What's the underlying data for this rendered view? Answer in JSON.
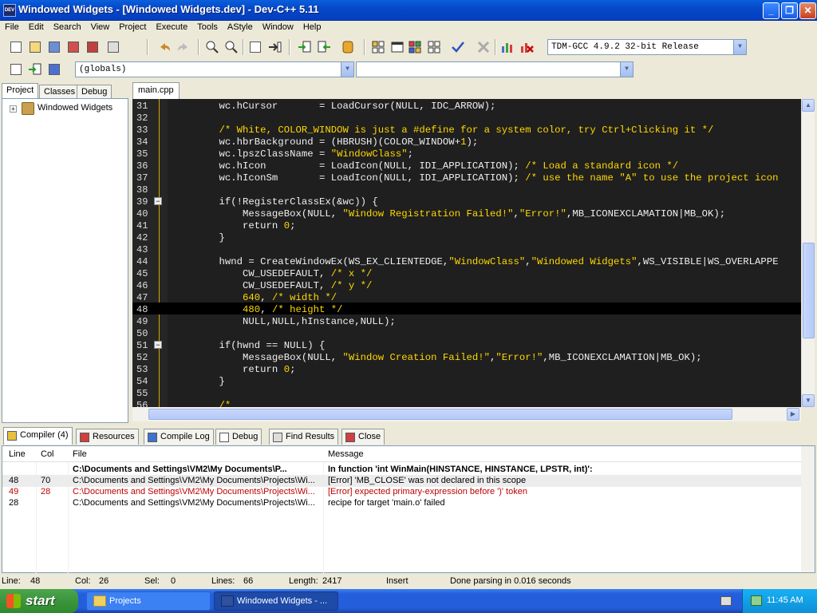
{
  "window": {
    "title": "Windowed Widgets - [Windowed Widgets.dev] - Dev-C++ 5.11",
    "icon_text": "DEV"
  },
  "menu": [
    "File",
    "Edit",
    "Search",
    "View",
    "Project",
    "Execute",
    "Tools",
    "AStyle",
    "Window",
    "Help"
  ],
  "compiler_select": "TDM-GCC 4.9.2 32-bit Release",
  "scope_select": "(globals)",
  "left_tabs": [
    "Project",
    "Classes",
    "Debug"
  ],
  "tree": {
    "root": "Windowed Widgets"
  },
  "editor_tab": "main.cpp",
  "code_lines": [
    {
      "n": "31",
      "t": "    wc.hCursor       = LoadCursor(NULL, IDC_ARROW);"
    },
    {
      "n": "32",
      "t": ""
    },
    {
      "n": "33",
      "t": "    /* White, COLOR_WINDOW is just a #define for a system color, try Ctrl+Clicking it */"
    },
    {
      "n": "34",
      "t": "    wc.hbrBackground = (HBRUSH)(COLOR_WINDOW+1);"
    },
    {
      "n": "35",
      "t": "    wc.lpszClassName = \"WindowClass\";"
    },
    {
      "n": "36",
      "t": "    wc.hIcon         = LoadIcon(NULL, IDI_APPLICATION); /* Load a standard icon */"
    },
    {
      "n": "37",
      "t": "    wc.hIconSm       = LoadIcon(NULL, IDI_APPLICATION); /* use the name \"A\" to use the project icon"
    },
    {
      "n": "38",
      "t": ""
    },
    {
      "n": "39",
      "t": "    if(!RegisterClassEx(&wc)) {"
    },
    {
      "n": "40",
      "t": "        MessageBox(NULL, \"Window Registration Failed!\",\"Error!\",MB_ICONEXCLAMATION|MB_OK);"
    },
    {
      "n": "41",
      "t": "        return 0;"
    },
    {
      "n": "42",
      "t": "    }"
    },
    {
      "n": "43",
      "t": ""
    },
    {
      "n": "44",
      "t": "    hwnd = CreateWindowEx(WS_EX_CLIENTEDGE,\"WindowClass\",\"Windowed Widgets\",WS_VISIBLE|WS_OVERLAPPE"
    },
    {
      "n": "45",
      "t": "        CW_USEDEFAULT, /* x */"
    },
    {
      "n": "46",
      "t": "        CW_USEDEFAULT, /* y */"
    },
    {
      "n": "47",
      "t": "        640, /* width */"
    },
    {
      "n": "48",
      "t": "        480, /* height */"
    },
    {
      "n": "49",
      "t": "        NULL,NULL,hInstance,NULL);"
    },
    {
      "n": "50",
      "t": ""
    },
    {
      "n": "51",
      "t": "    if(hwnd == NULL) {"
    },
    {
      "n": "52",
      "t": "        MessageBox(NULL, \"Window Creation Failed!\",\"Error!\",MB_ICONEXCLAMATION|MB_OK);"
    },
    {
      "n": "53",
      "t": "        return 0;"
    },
    {
      "n": "54",
      "t": "    }"
    },
    {
      "n": "55",
      "t": ""
    },
    {
      "n": "56",
      "t": "    /*"
    }
  ],
  "bottom_tabs": [
    "Compiler (4)",
    "Resources",
    "Compile Log",
    "Debug",
    "Find Results",
    "Close"
  ],
  "messages": {
    "headers": [
      "Line",
      "Col",
      "File",
      "Message"
    ],
    "rows": [
      {
        "line": "",
        "col": "",
        "file": "C:\\Documents and Settings\\VM2\\My Documents\\P...",
        "msg": "In function 'int WinMain(HINSTANCE, HINSTANCE, LPSTR, int)':",
        "bold": true
      },
      {
        "line": "48",
        "col": "70",
        "file": "C:\\Documents and Settings\\VM2\\My Documents\\Projects\\Wi...",
        "msg": "[Error] 'MB_CLOSE' was not declared in this scope"
      },
      {
        "line": "49",
        "col": "28",
        "file": "C:\\Documents and Settings\\VM2\\My Documents\\Projects\\Wi...",
        "msg": "[Error] expected primary-expression before ')' token",
        "error": true
      },
      {
        "line": "28",
        "col": "",
        "file": "C:\\Documents and Settings\\VM2\\My Documents\\Projects\\Wi...",
        "msg": "recipe for target 'main.o' failed"
      }
    ]
  },
  "status": {
    "line_label": "Line:",
    "line": "48",
    "col_label": "Col:",
    "col": "26",
    "sel_label": "Sel:",
    "sel": "0",
    "lines_label": "Lines:",
    "lines": "66",
    "length_label": "Length:",
    "length": "2417",
    "mode": "Insert",
    "message": "Done parsing in 0.016 seconds"
  },
  "taskbar": {
    "start": "start",
    "tasks": [
      "Projects",
      "Windowed Widgets - ..."
    ],
    "clock": "11:45 AM"
  }
}
